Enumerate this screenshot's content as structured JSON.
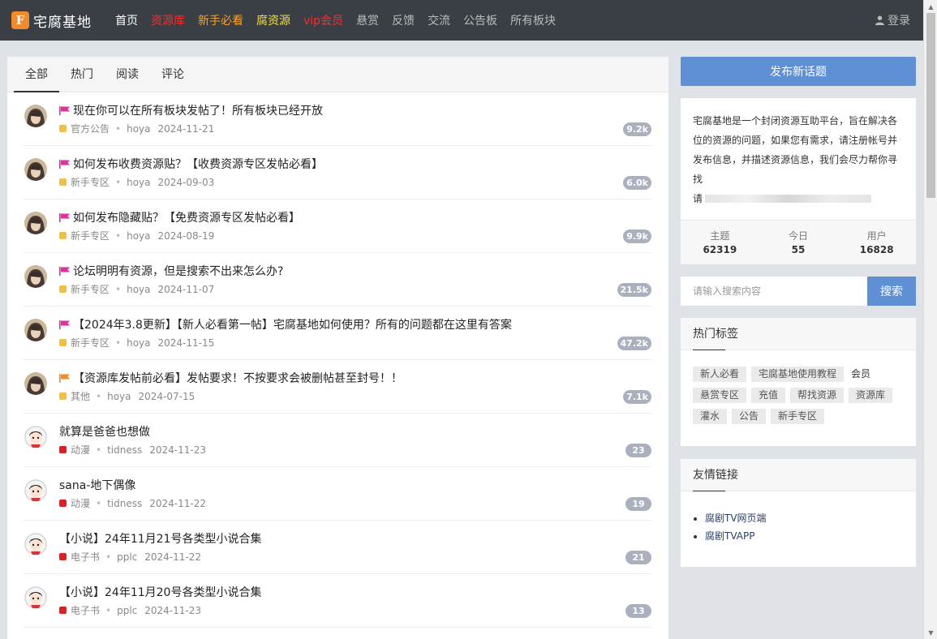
{
  "header": {
    "logo_mark": "F",
    "site_name": "宅腐基地",
    "nav": [
      "首页",
      "资源库",
      "新手必看",
      "腐资源",
      "vip会员",
      "悬赏",
      "反馈",
      "交流",
      "公告板",
      "所有板块"
    ],
    "login_label": "登录",
    "nav_colors": [
      "#ffffff",
      "#ff2a2a",
      "#f6a12a",
      "#f6e02a",
      "#ff2a2a",
      "#bbbbbb",
      "#bbbbbb",
      "#bbbbbb",
      "#bbbbbb",
      "#bbbbbb"
    ]
  },
  "tabs": [
    "全部",
    "热门",
    "阅读",
    "评论"
  ],
  "topics": [
    {
      "title": "现在你可以在所有板块发帖了！所有板块已经开放",
      "flag": "magenta",
      "category": "官方公告",
      "cat_color": "#f0c040",
      "author": "hoya",
      "date": "2024-11-21",
      "count": "9.2k"
    },
    {
      "title": "如何发布收费资源贴？【收费资源专区发帖必看】",
      "flag": "magenta",
      "category": "新手专区",
      "cat_color": "#f0c040",
      "author": "hoya",
      "date": "2024-09-03",
      "count": "6.0k"
    },
    {
      "title": "如何发布隐藏贴？【免费资源专区发帖必看】",
      "flag": "magenta",
      "category": "新手专区",
      "cat_color": "#f0c040",
      "author": "hoya",
      "date": "2024-08-19",
      "count": "9.9k"
    },
    {
      "title": "论坛明明有资源，但是搜索不出来怎么办?",
      "flag": "magenta",
      "category": "新手专区",
      "cat_color": "#f0c040",
      "author": "hoya",
      "date": "2024-11-07",
      "count": "21.5k"
    },
    {
      "title": "【2024年3.8更新】【新人必看第一帖】宅腐基地如何使用？所有的问题都在这里有答案",
      "flag": "magenta",
      "category": "新手专区",
      "cat_color": "#f0c040",
      "author": "hoya",
      "date": "2024-11-15",
      "count": "47.2k"
    },
    {
      "title": "【资源库发帖前必看】发帖要求！不按要求会被删帖甚至封号！！",
      "flag": "orange",
      "category": "其他",
      "cat_color": "#f0c040",
      "author": "hoya",
      "date": "2024-07-15",
      "count": "7.1k"
    },
    {
      "title": "就算是爸爸也想做",
      "flag": "",
      "category": "动漫",
      "cat_color": "#e02020",
      "author": "tidness",
      "date": "2024-11-23",
      "count": "23"
    },
    {
      "title": "sana-地下偶像",
      "flag": "",
      "category": "动漫",
      "cat_color": "#e02020",
      "author": "tidness",
      "date": "2024-11-22",
      "count": "19"
    },
    {
      "title": "【小说】24年11月21号各类型小说合集",
      "flag": "",
      "category": "电子书",
      "cat_color": "#e02020",
      "author": "pplc",
      "date": "2024-11-22",
      "count": "21"
    },
    {
      "title": "【小说】24年11月20号各类型小说合集",
      "flag": "",
      "category": "电子书",
      "cat_color": "#e02020",
      "author": "pplc",
      "date": "2024-11-23",
      "count": "13"
    }
  ],
  "sidebar": {
    "new_topic_label": "发布新话题",
    "intro": "宅腐基地是一个封闭资源互助平台，旨在解决各位的资源的问题，如果您有需求，请注册帐号并发布信息，并描述资源信息，我们会尽力帮你寻找",
    "intro_blur_prefix": "请",
    "stats": [
      {
        "label": "主题",
        "value": "62319"
      },
      {
        "label": "今日",
        "value": "55"
      },
      {
        "label": "用户",
        "value": "16828"
      }
    ],
    "search_placeholder": "请输入搜索内容",
    "search_label": "搜索",
    "tags_title": "热门标签",
    "tags": [
      "新人必看",
      "宅腐基地使用教程",
      "会员",
      "悬赏专区",
      "充值",
      "帮找资源",
      "资源库",
      "灌水",
      "公告",
      "新手专区"
    ],
    "links_title": "友情链接",
    "links": [
      "腐剧TV网页端",
      "腐剧TVAPP"
    ]
  }
}
